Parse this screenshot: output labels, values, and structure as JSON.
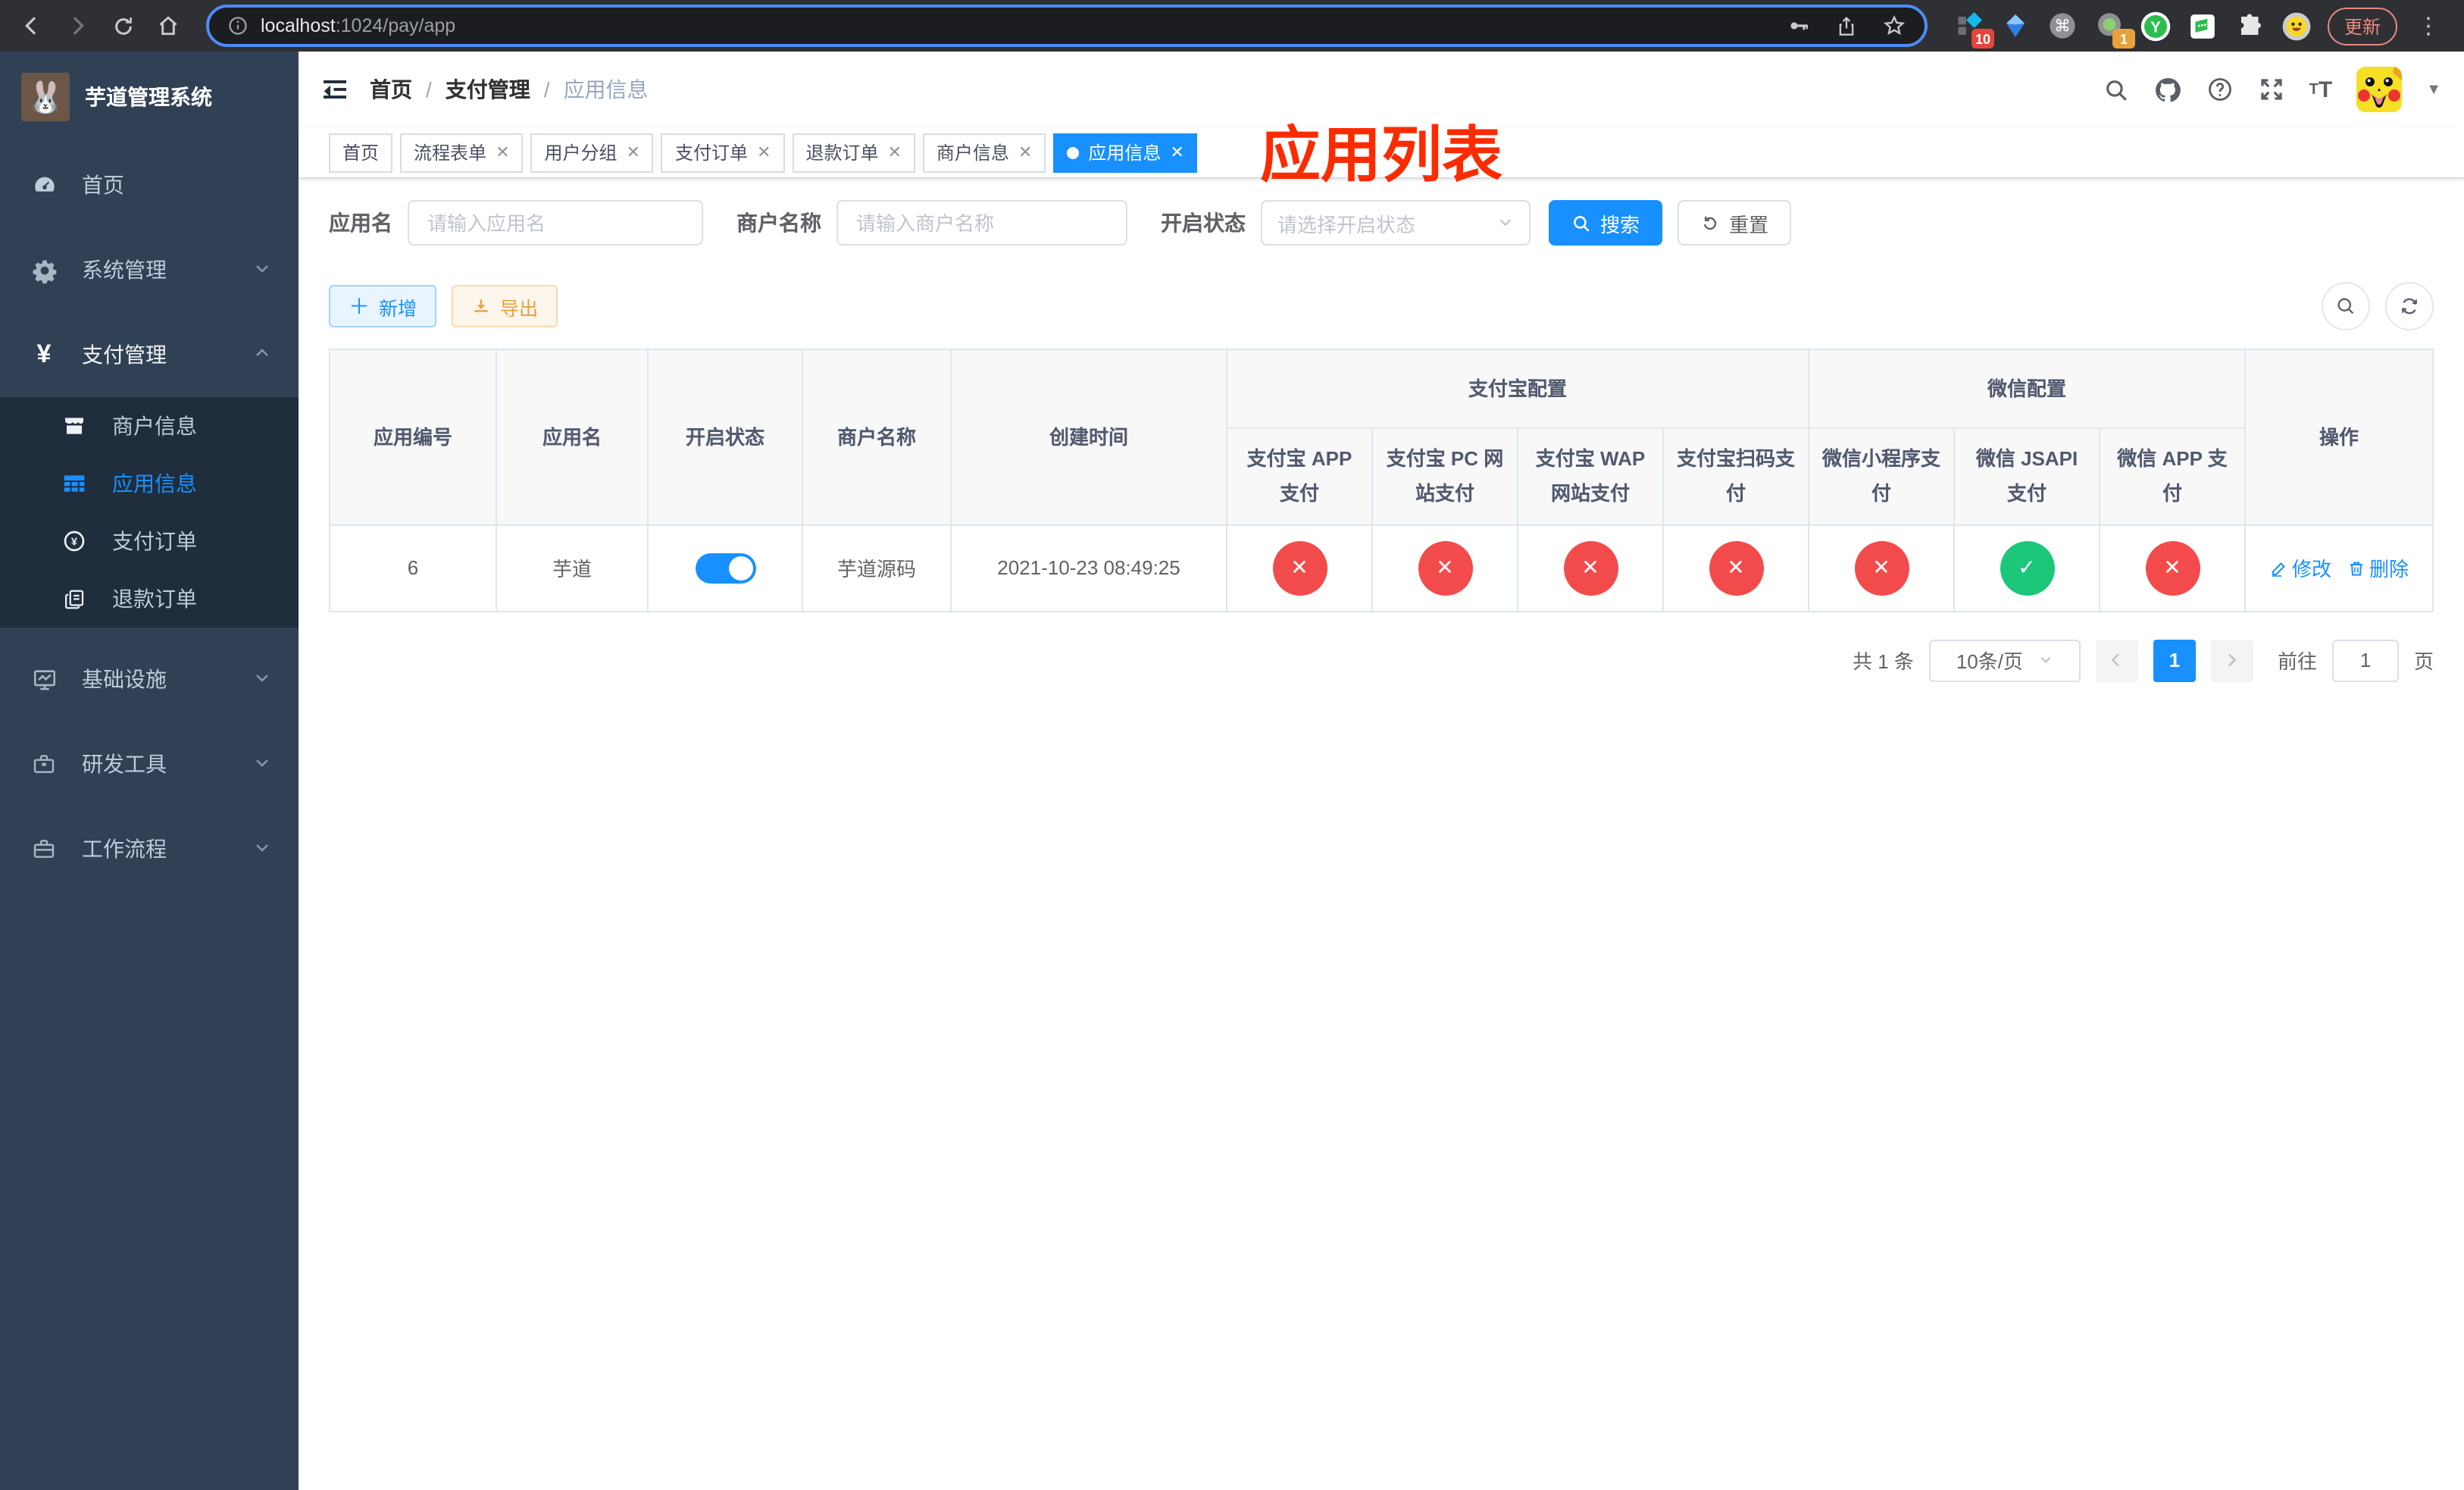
{
  "browser": {
    "url_host": "localhost",
    "url_path": ":1024/pay/app",
    "update_label": "更新",
    "ext_badge_ten": "10",
    "ext_badge_one": "1",
    "ext_y_letter": "Y"
  },
  "sidebar": {
    "title": "芋道管理系统",
    "logo_emoji": "🐰",
    "menu_home": "首页",
    "menu_system": "系统管理",
    "menu_pay": "支付管理",
    "sub_merchant": "商户信息",
    "sub_app": "应用信息",
    "sub_pay_order": "支付订单",
    "sub_refund_order": "退款订单",
    "menu_infra": "基础设施",
    "menu_dev": "研发工具",
    "menu_workflow": "工作流程"
  },
  "header": {
    "breadcrumb_home": "首页",
    "breadcrumb_section": "支付管理",
    "breadcrumb_current": "应用信息",
    "annotation": "应用列表"
  },
  "tabs": {
    "t0": "首页",
    "t1": "流程表单",
    "t2": "用户分组",
    "t3": "支付订单",
    "t4": "退款订单",
    "t5": "商户信息",
    "t6": "应用信息"
  },
  "filters": {
    "app_name_label": "应用名",
    "app_name_placeholder": "请输入应用名",
    "merchant_label": "商户名称",
    "merchant_placeholder": "请输入商户名称",
    "status_label": "开启状态",
    "status_placeholder": "请选择开启状态",
    "search_label": "搜索",
    "reset_label": "重置"
  },
  "toolbar": {
    "add_label": "新增",
    "export_label": "导出"
  },
  "table": {
    "headers": {
      "id": "应用编号",
      "name": "应用名",
      "status": "开启状态",
      "merchant": "商户名称",
      "created": "创建时间",
      "alipay_group": "支付宝配置",
      "wechat_group": "微信配置",
      "op": "操作",
      "alipay_app": "支付宝 APP 支付",
      "alipay_pc": "支付宝 PC 网站支付",
      "alipay_wap": "支付宝 WAP 网站支付",
      "alipay_qr": "支付宝扫码支付",
      "wx_mini": "微信小程序支付",
      "wx_jsapi": "微信 JSAPI 支付",
      "wx_app": "微信 APP 支付"
    },
    "row": {
      "id": "6",
      "name": "芋道",
      "enabled": true,
      "merchant": "芋道源码",
      "created": "2021-10-23 08:49:25",
      "configs": [
        "cross",
        "cross",
        "cross",
        "cross",
        "cross",
        "check",
        "cross"
      ],
      "edit_label": "修改",
      "delete_label": "删除"
    }
  },
  "pagination": {
    "total": "共 1 条",
    "page_size": "10条/页",
    "page": "1",
    "goto_label": "前往",
    "goto_value": "1",
    "unit_label": "页"
  },
  "colors": {
    "primary": "#1890ff",
    "danger": "#f34b4b",
    "success": "#1dc779",
    "annotation_red": "#fb2b00",
    "sidebar_bg": "#304156",
    "submenu_bg": "#1f2d3d"
  }
}
